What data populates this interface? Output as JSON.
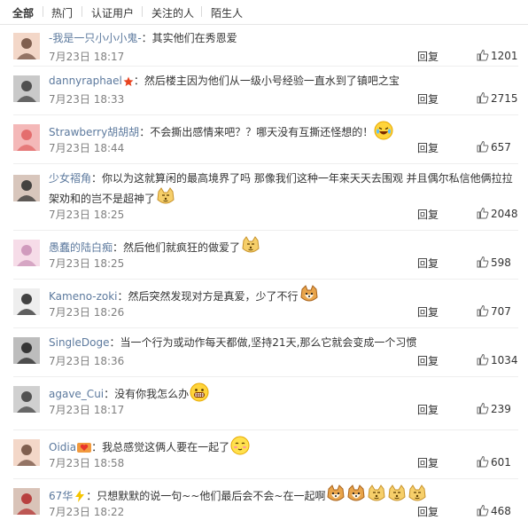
{
  "tabs": [
    "全部",
    "热门",
    "认证用户",
    "关注的人",
    "陌生人"
  ],
  "reply_label": "回复",
  "comments": [
    {
      "user": "-我是一只小小小鬼-",
      "text": "：其实他们在秀恩爱",
      "time": "7月23日 18:17",
      "likes": "1201",
      "avatar": "avatar-girl-icon",
      "emojis": []
    },
    {
      "user": "dannyraphael",
      "text": "：然后楼主因为他们从一级小号经验一直水到了镇吧之宝",
      "time": "7月23日 18:33",
      "likes": "2715",
      "avatar": "avatar-group-icon",
      "emojis": [
        "red-star-badge-icon"
      ]
    },
    {
      "user": "Strawberry胡胡胡",
      "text": "：不会撕出感情来吧？？哪天没有互撕还怪想的！",
      "time": "7月23日 18:44",
      "likes": "657",
      "avatar": "avatar-cartoon-icon",
      "emojis": [
        "laugh-tears-emoji-icon"
      ]
    },
    {
      "user": "少女褶角",
      "text": "：你以为这就算闲的最高境界了吗 那像我们这种一年来天天去围观 并且偶尔私信他俩拉拉架劝和的岂不是超神了",
      "time": "7月23日 18:25",
      "likes": "2048",
      "avatar": "avatar-girl-dark-icon",
      "emojis": [
        "doge-emoji-icon"
      ]
    },
    {
      "user": "愚蠢的陆白痴",
      "text": "：然后他们就疯狂的做爱了",
      "time": "7月23日 18:25",
      "likes": "598",
      "avatar": "avatar-pink-icon",
      "emojis": [
        "doge-emoji-icon"
      ]
    },
    {
      "user": "Kameno-zoki",
      "text": "：然后突然发现对方是真爱，少了不行",
      "time": "7月23日 18:26",
      "likes": "707",
      "avatar": "avatar-white-icon",
      "emojis": [
        "shiba-emoji-icon"
      ]
    },
    {
      "user": "SingleDoge",
      "text": "：当一个行为或动作每天都做,坚持21天,那么它就会变成一个习惯",
      "time": "7月23日 18:36",
      "likes": "1034",
      "avatar": "avatar-dark-icon",
      "emojis": []
    },
    {
      "user": "agave_Cui",
      "text": "：没有你我怎么办",
      "time": "7月23日 18:17",
      "likes": "239",
      "avatar": "avatar-gray-icon",
      "emojis": [
        "grin-emoji-icon"
      ]
    },
    {
      "user": "Oidia",
      "text": "：我总感觉这俩人要在一起了",
      "time": "7月23日 18:58",
      "likes": "601",
      "avatar": "avatar-girl-icon",
      "emojis": [
        "heart-badge-icon",
        "blush-emoji-icon"
      ]
    },
    {
      "user": "67华",
      "text": "：只想默默的说一句~~他们最后会不会~在一起啊",
      "time": "7月23日 18:22",
      "likes": "468",
      "avatar": "avatar-red-icon",
      "emojis": [
        "lightning-badge-icon",
        "shiba-emoji-icon",
        "shiba-emoji-icon",
        "doge-emoji-icon",
        "doge-emoji-icon",
        "doge-emoji-icon"
      ]
    }
  ],
  "colors": {
    "username": "#5d7a9e",
    "meta": "#808080",
    "text": "#333333"
  }
}
